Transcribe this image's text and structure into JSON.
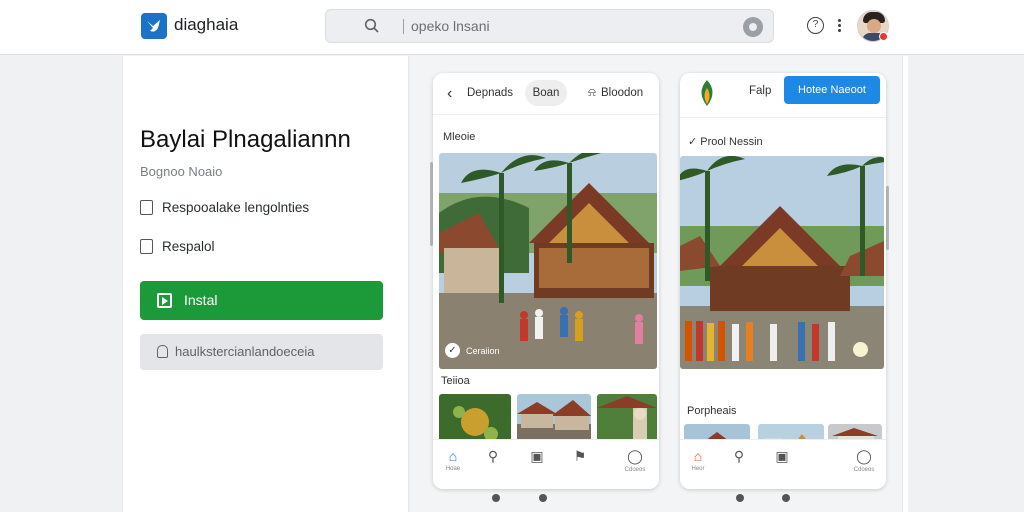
{
  "header": {
    "brand": "diaghaia",
    "search_placeholder": "opeko lnsani",
    "help_glyph": "?"
  },
  "left": {
    "title": "Baylai Plnagaliannn",
    "subtitle": "Bognoo Noaio",
    "options": [
      "Respooalake lengolnties",
      "Respalol"
    ],
    "install_label": "Instal",
    "secondary_label": "haulkstercianlandoeceia"
  },
  "phone1": {
    "back_glyph": "‹",
    "tab_a": "Depnads",
    "chip": "Boan",
    "tab_b": "Bloodon",
    "section1": "Mleoie",
    "section2": "Teiioa",
    "caption": "Ceraiion",
    "tabbar": [
      {
        "icon": "home-icon",
        "glyph": "⌂",
        "label": "Hoae"
      },
      {
        "icon": "search-icon",
        "glyph": "⚲",
        "label": ""
      },
      {
        "icon": "calendar-icon",
        "glyph": "▣",
        "label": ""
      },
      {
        "icon": "bookmark-icon",
        "glyph": "⚑",
        "label": ""
      },
      {
        "icon": "profile-icon",
        "glyph": "◯",
        "label": "Cdoeos"
      }
    ]
  },
  "phone2": {
    "title": "Falp",
    "button_label": "Hotee Naeoot",
    "section1": "Prool Nessin",
    "section2": "Porpheais",
    "tabbar": [
      {
        "icon": "home-icon",
        "glyph": "⌂",
        "label": "Heor"
      },
      {
        "icon": "search-icon",
        "glyph": "⚲",
        "label": ""
      },
      {
        "icon": "calendar-icon",
        "glyph": "▣",
        "label": ""
      },
      {
        "icon": "profile-icon",
        "glyph": "◯",
        "label": "Cdoeos"
      }
    ]
  },
  "colors": {
    "install_green": "#1c9a3a",
    "brand_blue": "#1a73c9",
    "phone_button_blue": "#1e88e5",
    "active_tab_orange": "#f4511e"
  }
}
